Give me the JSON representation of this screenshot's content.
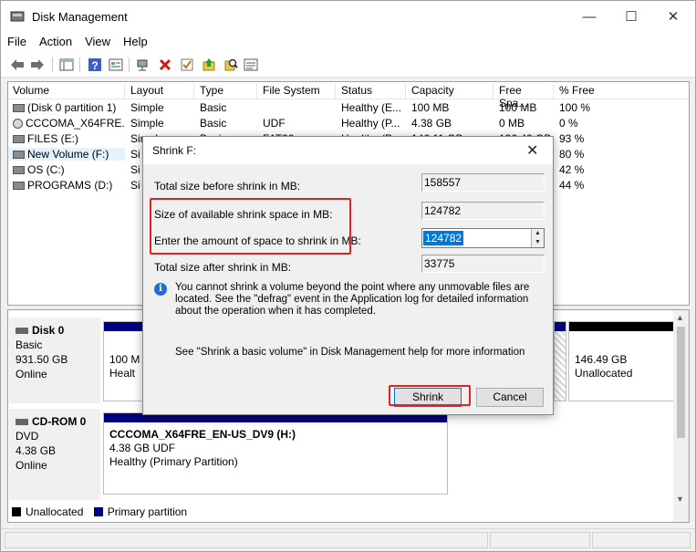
{
  "window": {
    "title": "Disk Management",
    "controls": {
      "minimize": "—",
      "maximize": "☐",
      "close": "✕"
    }
  },
  "menu": [
    "File",
    "Action",
    "View",
    "Help"
  ],
  "toolbar_icons": [
    "back-arrow-icon",
    "forward-arrow-icon",
    "console-tree-icon",
    "help-icon",
    "properties-icon",
    "connect-icon",
    "delete-icon",
    "check-icon",
    "up-folder-icon",
    "search-icon",
    "details-icon"
  ],
  "volume_list": {
    "columns": [
      "Volume",
      "Layout",
      "Type",
      "File System",
      "Status",
      "Capacity",
      "Free Spa...",
      "% Free"
    ],
    "rows": [
      {
        "volume": "(Disk 0 partition 1)",
        "layout": "Simple",
        "type": "Basic",
        "fs": "",
        "status": "Healthy (E...",
        "capacity": "100 MB",
        "free": "100 MB",
        "pct": "100 %",
        "icon": "drive-icon"
      },
      {
        "volume": "CCCOMA_X64FRE...",
        "layout": "Simple",
        "type": "Basic",
        "fs": "UDF",
        "status": "Healthy (P...",
        "capacity": "4.38 GB",
        "free": "0 MB",
        "pct": "0 %",
        "icon": "cd-icon"
      },
      {
        "volume": "FILES (E:)",
        "layout": "Simple",
        "type": "Basic",
        "fs": "FAT32",
        "status": "Healthy (P...",
        "capacity": "146.11 GB",
        "free": "136.42 GB",
        "pct": "93 %",
        "icon": "drive-icon"
      },
      {
        "volume": "New Volume (F:)",
        "layout": "Si",
        "type": "",
        "fs": "",
        "status": "",
        "capacity": "",
        "free": "",
        "pct": "80 %",
        "icon": "drive-icon"
      },
      {
        "volume": "OS (C:)",
        "layout": "Si",
        "type": "",
        "fs": "",
        "status": "",
        "capacity": "",
        "free": "",
        "pct": "42 %",
        "icon": "drive-icon"
      },
      {
        "volume": "PROGRAMS (D:)",
        "layout": "Si",
        "type": "",
        "fs": "",
        "status": "",
        "capacity": "",
        "free": "",
        "pct": "44 %",
        "icon": "drive-icon"
      }
    ]
  },
  "disks": [
    {
      "name": "Disk 0",
      "type": "Basic",
      "size": "931.50 GB",
      "state": "Online",
      "partitions": [
        {
          "line1": "100 M",
          "line2": "Healt"
        },
        {
          "line1": "146.49 GB",
          "line2": "Unallocated"
        }
      ]
    },
    {
      "name": "CD-ROM 0",
      "type": "DVD",
      "size": "4.38 GB",
      "state": "Online",
      "partitions": [
        {
          "line1": "CCCOMA_X64FRE_EN-US_DV9  (H:)",
          "line2": "4.38 GB UDF",
          "line3": "Healthy (Primary Partition)"
        }
      ]
    }
  ],
  "legend": [
    {
      "label": "Unallocated",
      "color": "#000000"
    },
    {
      "label": "Primary partition",
      "color": "#000080"
    }
  ],
  "dialog": {
    "title": "Shrink F:",
    "total_before_label": "Total size before shrink in MB:",
    "total_before_value": "158557",
    "available_label": "Size of available shrink space in MB:",
    "available_value": "124782",
    "enter_label": "Enter the amount of space to shrink in MB:",
    "enter_value": "124782",
    "total_after_label": "Total size after shrink in MB:",
    "total_after_value": "33775",
    "info": "You cannot shrink a volume beyond the point where any unmovable files are located. See the \"defrag\" event in the Application log for detailed information about the operation when it has completed.",
    "help": "See \"Shrink a basic volume\" in Disk Management help for more information",
    "shrink_button": "Shrink",
    "cancel_button": "Cancel"
  },
  "colors": {
    "primary_partition": "#000080",
    "highlight": "#e02424",
    "selection": "#0078d7"
  }
}
